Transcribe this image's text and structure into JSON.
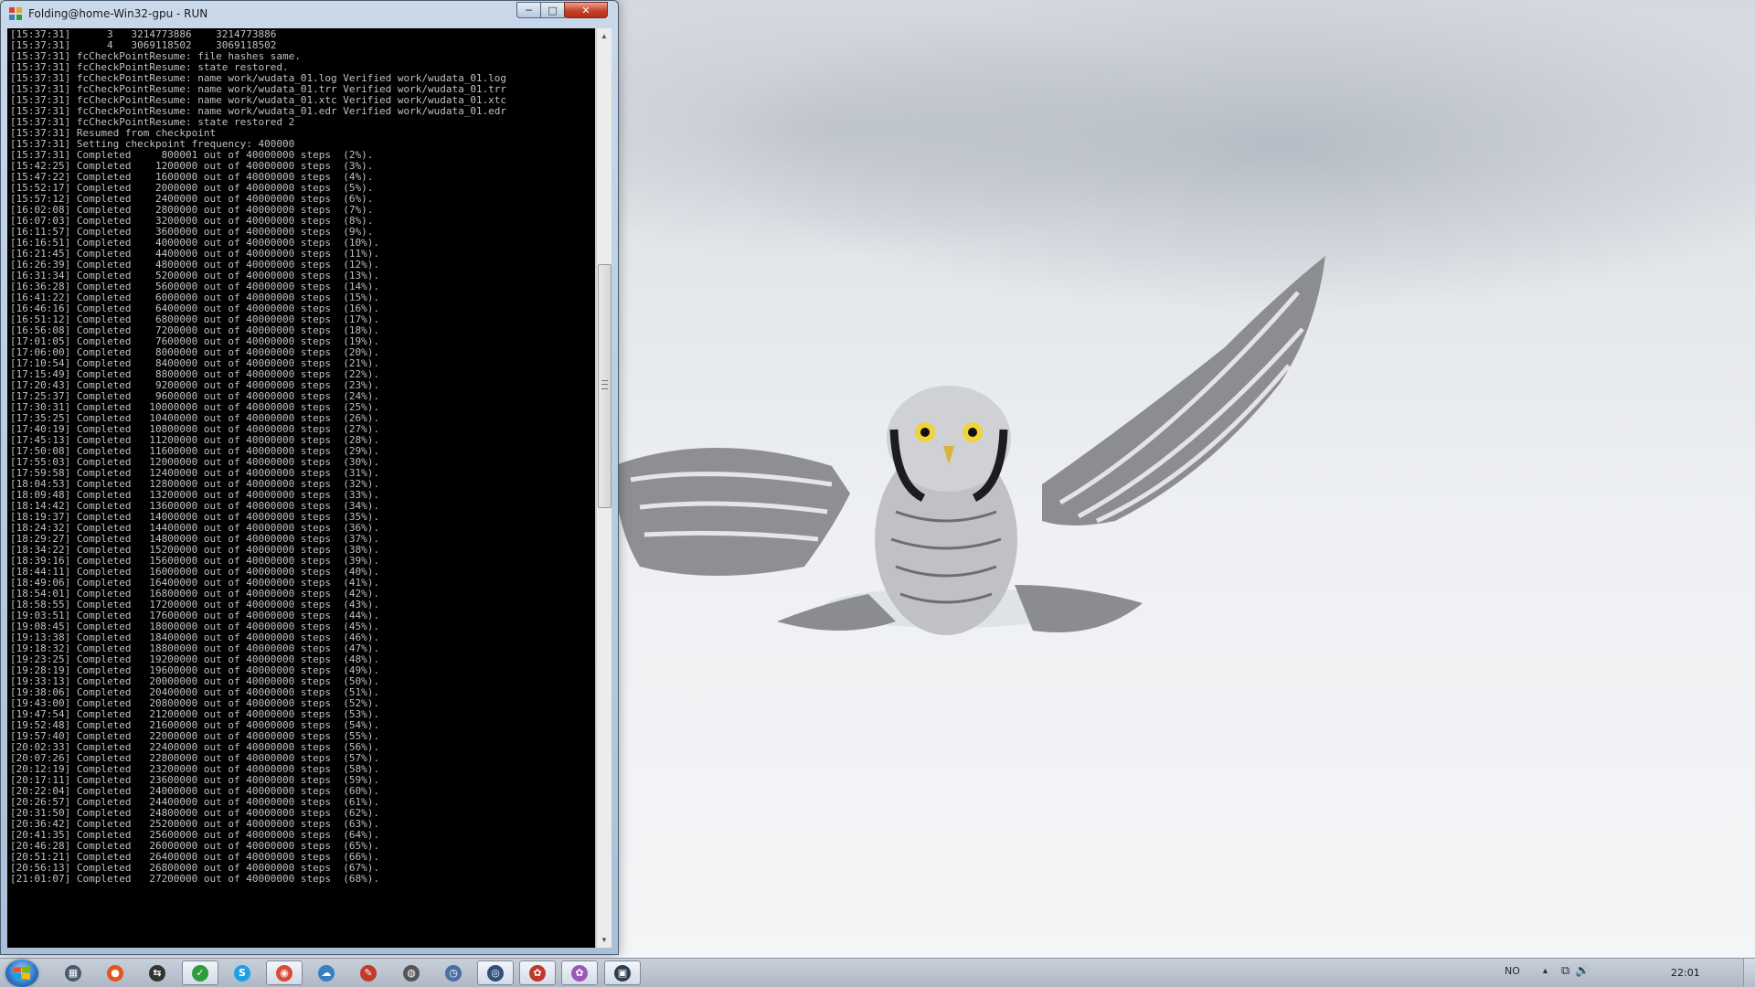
{
  "window": {
    "title": "Folding@home-Win32-gpu - RUN",
    "min_glyph": "─",
    "max_glyph": "□",
    "close_glyph": "✕"
  },
  "console": {
    "lines": [
      "[15:37:31]      3   3214773886    3214773886",
      "[15:37:31]      4   3069118502    3069118502",
      "[15:37:31] fcCheckPointResume: file hashes same.",
      "[15:37:31] fcCheckPointResume: state restored.",
      "[15:37:31] fcCheckPointResume: name work/wudata_01.log Verified work/wudata_01.log",
      "[15:37:31] fcCheckPointResume: name work/wudata_01.trr Verified work/wudata_01.trr",
      "[15:37:31] fcCheckPointResume: name work/wudata_01.xtc Verified work/wudata_01.xtc",
      "[15:37:31] fcCheckPointResume: name work/wudata_01.edr Verified work/wudata_01.edr",
      "[15:37:31] fcCheckPointResume: state restored 2",
      "[15:37:31] Resumed from checkpoint",
      "[15:37:31] Setting checkpoint frequency: 400000",
      "[15:37:31] Completed     800001 out of 40000000 steps  (2%).",
      "[15:42:25] Completed    1200000 out of 40000000 steps  (3%).",
      "[15:47:22] Completed    1600000 out of 40000000 steps  (4%).",
      "[15:52:17] Completed    2000000 out of 40000000 steps  (5%).",
      "[15:57:12] Completed    2400000 out of 40000000 steps  (6%).",
      "[16:02:08] Completed    2800000 out of 40000000 steps  (7%).",
      "[16:07:03] Completed    3200000 out of 40000000 steps  (8%).",
      "[16:11:57] Completed    3600000 out of 40000000 steps  (9%).",
      "[16:16:51] Completed    4000000 out of 40000000 steps  (10%).",
      "[16:21:45] Completed    4400000 out of 40000000 steps  (11%).",
      "[16:26:39] Completed    4800000 out of 40000000 steps  (12%).",
      "[16:31:34] Completed    5200000 out of 40000000 steps  (13%).",
      "[16:36:28] Completed    5600000 out of 40000000 steps  (14%).",
      "[16:41:22] Completed    6000000 out of 40000000 steps  (15%).",
      "[16:46:16] Completed    6400000 out of 40000000 steps  (16%).",
      "[16:51:12] Completed    6800000 out of 40000000 steps  (17%).",
      "[16:56:08] Completed    7200000 out of 40000000 steps  (18%).",
      "[17:01:05] Completed    7600000 out of 40000000 steps  (19%).",
      "[17:06:00] Completed    8000000 out of 40000000 steps  (20%).",
      "[17:10:54] Completed    8400000 out of 40000000 steps  (21%).",
      "[17:15:49] Completed    8800000 out of 40000000 steps  (22%).",
      "[17:20:43] Completed    9200000 out of 40000000 steps  (23%).",
      "[17:25:37] Completed    9600000 out of 40000000 steps  (24%).",
      "[17:30:31] Completed   10000000 out of 40000000 steps  (25%).",
      "[17:35:25] Completed   10400000 out of 40000000 steps  (26%).",
      "[17:40:19] Completed   10800000 out of 40000000 steps  (27%).",
      "[17:45:13] Completed   11200000 out of 40000000 steps  (28%).",
      "[17:50:08] Completed   11600000 out of 40000000 steps  (29%).",
      "[17:55:03] Completed   12000000 out of 40000000 steps  (30%).",
      "[17:59:58] Completed   12400000 out of 40000000 steps  (31%).",
      "[18:04:53] Completed   12800000 out of 40000000 steps  (32%).",
      "[18:09:48] Completed   13200000 out of 40000000 steps  (33%).",
      "[18:14:42] Completed   13600000 out of 40000000 steps  (34%).",
      "[18:19:37] Completed   14000000 out of 40000000 steps  (35%).",
      "[18:24:32] Completed   14400000 out of 40000000 steps  (36%).",
      "[18:29:27] Completed   14800000 out of 40000000 steps  (37%).",
      "[18:34:22] Completed   15200000 out of 40000000 steps  (38%).",
      "[18:39:16] Completed   15600000 out of 40000000 steps  (39%).",
      "[18:44:11] Completed   16000000 out of 40000000 steps  (40%).",
      "[18:49:06] Completed   16400000 out of 40000000 steps  (41%).",
      "[18:54:01] Completed   16800000 out of 40000000 steps  (42%).",
      "[18:58:55] Completed   17200000 out of 40000000 steps  (43%).",
      "[19:03:51] Completed   17600000 out of 40000000 steps  (44%).",
      "[19:08:45] Completed   18000000 out of 40000000 steps  (45%).",
      "[19:13:38] Completed   18400000 out of 40000000 steps  (46%).",
      "[19:18:32] Completed   18800000 out of 40000000 steps  (47%).",
      "[19:23:25] Completed   19200000 out of 40000000 steps  (48%).",
      "[19:28:19] Completed   19600000 out of 40000000 steps  (49%).",
      "[19:33:13] Completed   20000000 out of 40000000 steps  (50%).",
      "[19:38:06] Completed   20400000 out of 40000000 steps  (51%).",
      "[19:43:00] Completed   20800000 out of 40000000 steps  (52%).",
      "[19:47:54] Completed   21200000 out of 40000000 steps  (53%).",
      "[19:52:48] Completed   21600000 out of 40000000 steps  (54%).",
      "[19:57:40] Completed   22000000 out of 40000000 steps  (55%).",
      "[20:02:33] Completed   22400000 out of 40000000 steps  (56%).",
      "[20:07:26] Completed   22800000 out of 40000000 steps  (57%).",
      "[20:12:19] Completed   23200000 out of 40000000 steps  (58%).",
      "[20:17:11] Completed   23600000 out of 40000000 steps  (59%).",
      "[20:22:04] Completed   24000000 out of 40000000 steps  (60%).",
      "[20:26:57] Completed   24400000 out of 40000000 steps  (61%).",
      "[20:31:50] Completed   24800000 out of 40000000 steps  (62%).",
      "[20:36:42] Completed   25200000 out of 40000000 steps  (63%).",
      "[20:41:35] Completed   25600000 out of 40000000 steps  (64%).",
      "[20:46:28] Completed   26000000 out of 40000000 steps  (65%).",
      "[20:51:21] Completed   26400000 out of 40000000 steps  (66%).",
      "[20:56:13] Completed   26800000 out of 40000000 steps  (67%).",
      "[21:01:07] Completed   27200000 out of 40000000 steps  (68%)."
    ]
  },
  "taskbar": {
    "items": [
      {
        "name": "taskbar-app-explorer",
        "glyph": "▦",
        "color": "#4a5a6a",
        "active": false
      },
      {
        "name": "taskbar-app-media",
        "glyph": "●",
        "color": "#e2571e",
        "active": false
      },
      {
        "name": "taskbar-app-tools",
        "glyph": "⇆",
        "color": "#333333",
        "active": false
      },
      {
        "name": "taskbar-app-green",
        "glyph": "✓",
        "color": "#2d9b3e",
        "active": true
      },
      {
        "name": "taskbar-app-skype",
        "glyph": "S",
        "color": "#1ea0e6",
        "active": false
      },
      {
        "name": "taskbar-app-chrome",
        "glyph": "◉",
        "color": "#d94a38",
        "active": true
      },
      {
        "name": "taskbar-app-network",
        "glyph": "☁",
        "color": "#3a7fc2",
        "active": false
      },
      {
        "name": "taskbar-app-pen",
        "glyph": "✎",
        "color": "#c0392b",
        "active": false
      },
      {
        "name": "taskbar-app-mouse",
        "glyph": "◍",
        "color": "#555555",
        "active": false
      },
      {
        "name": "taskbar-app-clock",
        "glyph": "◷",
        "color": "#4a6fa5",
        "active": false
      },
      {
        "name": "taskbar-app-steam",
        "glyph": "◎",
        "color": "#2f4f7f",
        "active": true
      },
      {
        "name": "taskbar-app-folding",
        "glyph": "✿",
        "color": "#c0392b",
        "active": true
      },
      {
        "name": "taskbar-app-folding2",
        "glyph": "✿",
        "color": "#9b59b6",
        "active": true
      },
      {
        "name": "taskbar-app-console",
        "glyph": "▣",
        "color": "#2c3e50",
        "active": true
      }
    ],
    "tray": {
      "language": "NO",
      "expand_glyph": "▲",
      "icons": "⧉🔊",
      "clock": "22:01"
    }
  },
  "colors": {
    "console_bg": "#000000",
    "console_fg": "#c0c0c0"
  }
}
